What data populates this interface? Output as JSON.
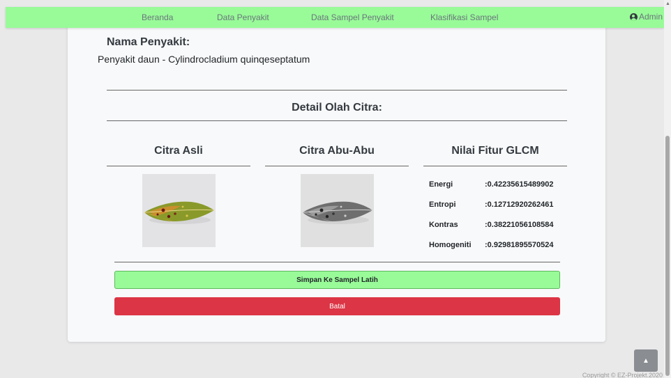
{
  "navbar": {
    "items": [
      {
        "label": "Beranda"
      },
      {
        "label": "Data Penyakit"
      },
      {
        "label": "Data Sampel Penyakit"
      },
      {
        "label": "Klasifikasi Sampel"
      }
    ],
    "user_label": "Admin",
    "accent_color": "#98fb98"
  },
  "disease": {
    "label": "Nama Penyakit:",
    "value": "Penyakit daun - Cylindrocladium quinqeseptatum"
  },
  "detail": {
    "title": "Detail Olah Citra:",
    "col_original": "Citra Asli",
    "col_gray": "Citra Abu-Abu",
    "col_features": "Nilai Fitur GLCM"
  },
  "features": [
    {
      "label": "Energi",
      "value": ":0.42235615489902"
    },
    {
      "label": "Entropi",
      "value": ":0.12712920262461"
    },
    {
      "label": "Kontras",
      "value": ":0.38221056108584"
    },
    {
      "label": "Homogeniti",
      "value": ":0.92981895570524"
    }
  ],
  "buttons": {
    "save_label": "Simpan Ke Sampel Latih",
    "cancel_label": "Batal",
    "save_color": "#98fb98",
    "cancel_color": "#dc3545"
  },
  "footer": {
    "copyright": "Copyright © EZ-Projekt.2020"
  },
  "icons": {
    "user": "user-circle-icon",
    "to_top": "chevron-up-icon"
  }
}
